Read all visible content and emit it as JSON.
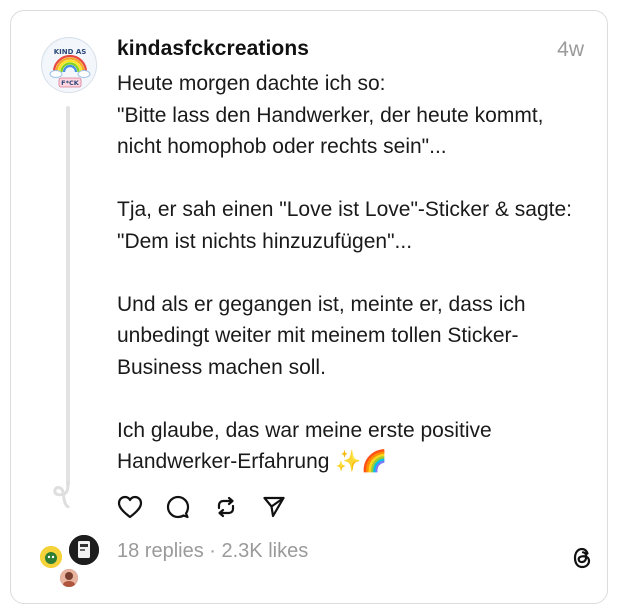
{
  "post": {
    "username": "kindasfckcreations",
    "time": "4w",
    "text": "Heute morgen dachte ich so:\n\"Bitte lass den Handwerker, der heute kommt, nicht homophob oder rechts sein\"...\n\nTja, er sah einen \"Love ist Love\"-Sticker & sagte: \"Dem ist nichts hinzuzufügen\"...\n\nUnd als er gegangen ist, meinte er, dass ich unbedingt weiter mit meinem tollen Sticker-Business machen soll.\n\nIch glaube, das war meine erste positive Handwerker-Erfahrung ✨🌈",
    "avatar_text_top": "KIND AS",
    "avatar_text_bottom": "F*CK"
  },
  "stats": {
    "replies": "18 replies",
    "separator": " · ",
    "likes": "2.3K likes"
  },
  "icons": {
    "actions": [
      "heart-icon",
      "comment-icon",
      "repost-icon",
      "share-icon"
    ],
    "logo": "threads-logo-icon"
  },
  "colors": {
    "text": "#1a1a1a",
    "muted": "#9a9a9a",
    "border": "#dcdcdc"
  }
}
